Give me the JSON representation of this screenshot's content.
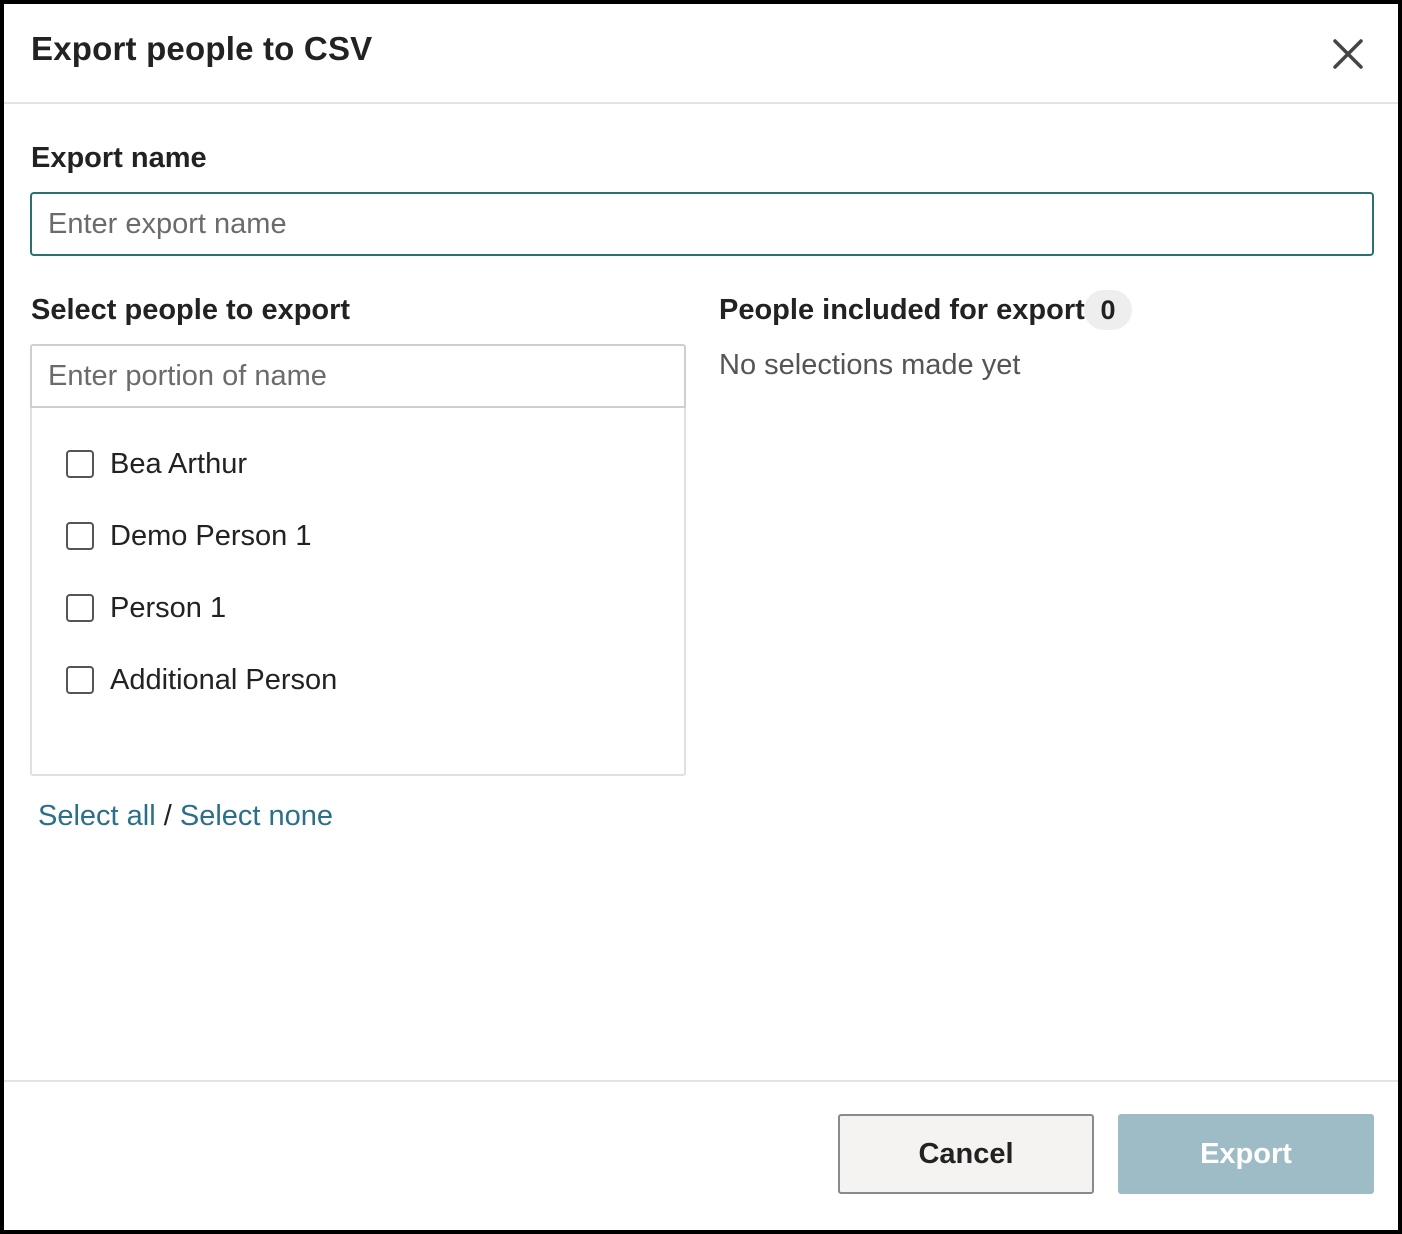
{
  "dialog": {
    "title": "Export people to CSV",
    "close_icon": "close-icon"
  },
  "export_name": {
    "label": "Export name",
    "value": "",
    "placeholder": "Enter export name"
  },
  "select_people": {
    "label": "Select people to export",
    "search_placeholder": "Enter portion of name",
    "search_value": "",
    "items": [
      {
        "label": "Bea Arthur",
        "checked": false
      },
      {
        "label": "Demo Person 1",
        "checked": false
      },
      {
        "label": "Person 1",
        "checked": false
      },
      {
        "label": "Additional Person",
        "checked": false
      }
    ],
    "select_all": "Select all",
    "separator": "/",
    "select_none": "Select none"
  },
  "included": {
    "label": "People included for export",
    "count": "0",
    "empty_text": "No selections made yet"
  },
  "footer": {
    "cancel_label": "Cancel",
    "export_label": "Export"
  },
  "colors": {
    "accent": "#2b6f72",
    "link": "#2b6f8a",
    "export_disabled": "#9dbcc6"
  }
}
